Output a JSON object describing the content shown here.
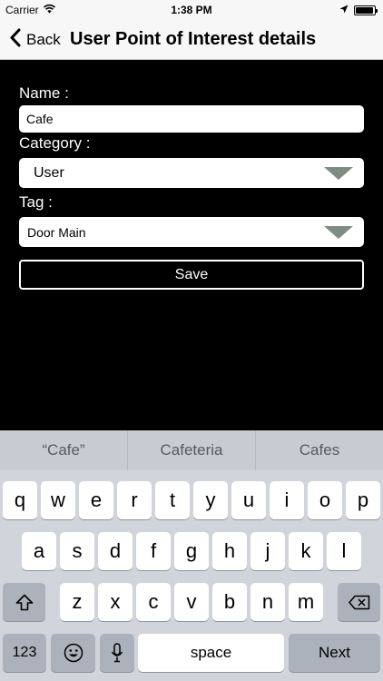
{
  "status_bar": {
    "carrier": "Carrier",
    "time": "1:38 PM",
    "battery_level": 0.95
  },
  "nav": {
    "back_label": "Back",
    "title": "User Point of Interest details"
  },
  "form": {
    "name_label": "Name :",
    "name_value": "Cafe",
    "category_label": "Category :",
    "category_value": "User",
    "tag_label": "Tag :",
    "tag_value": "Door Main",
    "save_label": "Save"
  },
  "keyboard": {
    "suggestions": [
      "“Cafe”",
      "Cafeteria",
      "Cafes"
    ],
    "row1": [
      "q",
      "w",
      "e",
      "r",
      "t",
      "y",
      "u",
      "i",
      "o",
      "p"
    ],
    "row2": [
      "a",
      "s",
      "d",
      "f",
      "g",
      "h",
      "j",
      "k",
      "l"
    ],
    "row3": [
      "z",
      "x",
      "c",
      "v",
      "b",
      "n",
      "m"
    ],
    "numbers_label": "123",
    "space_label": "space",
    "next_label": "Next"
  },
  "icons": {
    "wifi": "wifi-icon",
    "location": "location-arrow-icon",
    "battery": "battery-icon",
    "back": "chevron-left-icon",
    "shift": "shift-icon",
    "delete": "delete-icon",
    "emoji": "emoji-icon",
    "mic": "microphone-icon"
  }
}
